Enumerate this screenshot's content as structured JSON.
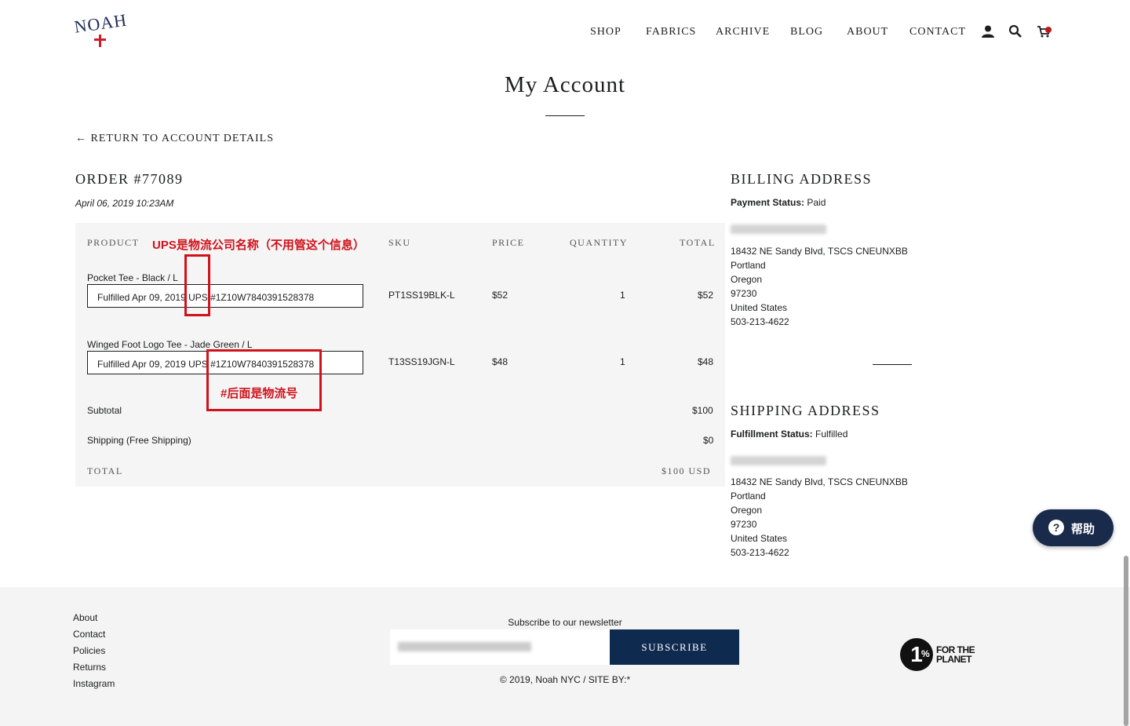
{
  "header": {
    "logo_text": "NOAH",
    "nav": [
      {
        "label": "SHOP"
      },
      {
        "label": "FABRICS"
      },
      {
        "label": "ARCHIVE"
      },
      {
        "label": "BLOG"
      },
      {
        "label": "ABOUT"
      },
      {
        "label": "CONTACT"
      }
    ],
    "icons": [
      "account-icon",
      "search-icon",
      "cart-icon"
    ],
    "cart_badge_color": "#c0151b"
  },
  "page_title": "My Account",
  "return_link": "← RETURN TO ACCOUNT DETAILS",
  "order": {
    "title": "ORDER #77089",
    "date": "April 06, 2019 10:23AM",
    "columns": {
      "product": "PRODUCT",
      "sku": "SKU",
      "price": "PRICE",
      "quantity": "QUANTITY",
      "total": "TOTAL"
    },
    "items": [
      {
        "name": "Pocket Tee - Black / L",
        "fulfillment": "Fulfilled Apr 09, 2019 UPS #1Z10W7840391528378",
        "sku": "PT1SS19BLK-L",
        "price": "$52",
        "quantity": "1",
        "total": "$52"
      },
      {
        "name": "Winged Foot Logo Tee - Jade Green / L",
        "fulfillment": "Fulfilled Apr 09, 2019 UPS #1Z10W7840391528378",
        "sku": "T13SS19JGN-L",
        "price": "$48",
        "quantity": "1",
        "total": "$48"
      }
    ],
    "subtotal_label": "Subtotal",
    "subtotal": "$100",
    "shipping_label": "Shipping (Free Shipping)",
    "shipping": "$0",
    "total_label": "TOTAL",
    "total": "$100 USD"
  },
  "annotations": {
    "ups_note": "UPS是物流公司名称（不用管这个信息）",
    "tracking_note": "#后面是物流号",
    "color": "#d0121b"
  },
  "billing": {
    "title": "BILLING ADDRESS",
    "status_label": "Payment Status:",
    "status": "Paid",
    "lines": [
      "18432 NE Sandy Blvd, TSCS CNEUNXBB",
      "Portland",
      "Oregon",
      "97230",
      "United States",
      "503-213-4622"
    ]
  },
  "shipping": {
    "title": "SHIPPING ADDRESS",
    "status_label": "Fulfillment Status:",
    "status": "Fulfilled",
    "lines": [
      "18432 NE Sandy Blvd, TSCS CNEUNXBB",
      "Portland",
      "Oregon",
      "97230",
      "United States",
      "503-213-4622"
    ]
  },
  "help_button": {
    "label": "帮助",
    "icon": "question-icon"
  },
  "footer": {
    "links": [
      "About",
      "Contact",
      "Policies",
      "Returns",
      "Instagram"
    ],
    "newsletter_label": "Subscribe to our newsletter",
    "subscribe_label": "SUBSCRIBE",
    "copyright": "© 2019, Noah NYC / SITE BY:*",
    "badge": {
      "number": "1",
      "percent": "%",
      "line1": "FOR THE",
      "line2": "PLANET"
    },
    "brand_color": "#0f2a4f"
  }
}
